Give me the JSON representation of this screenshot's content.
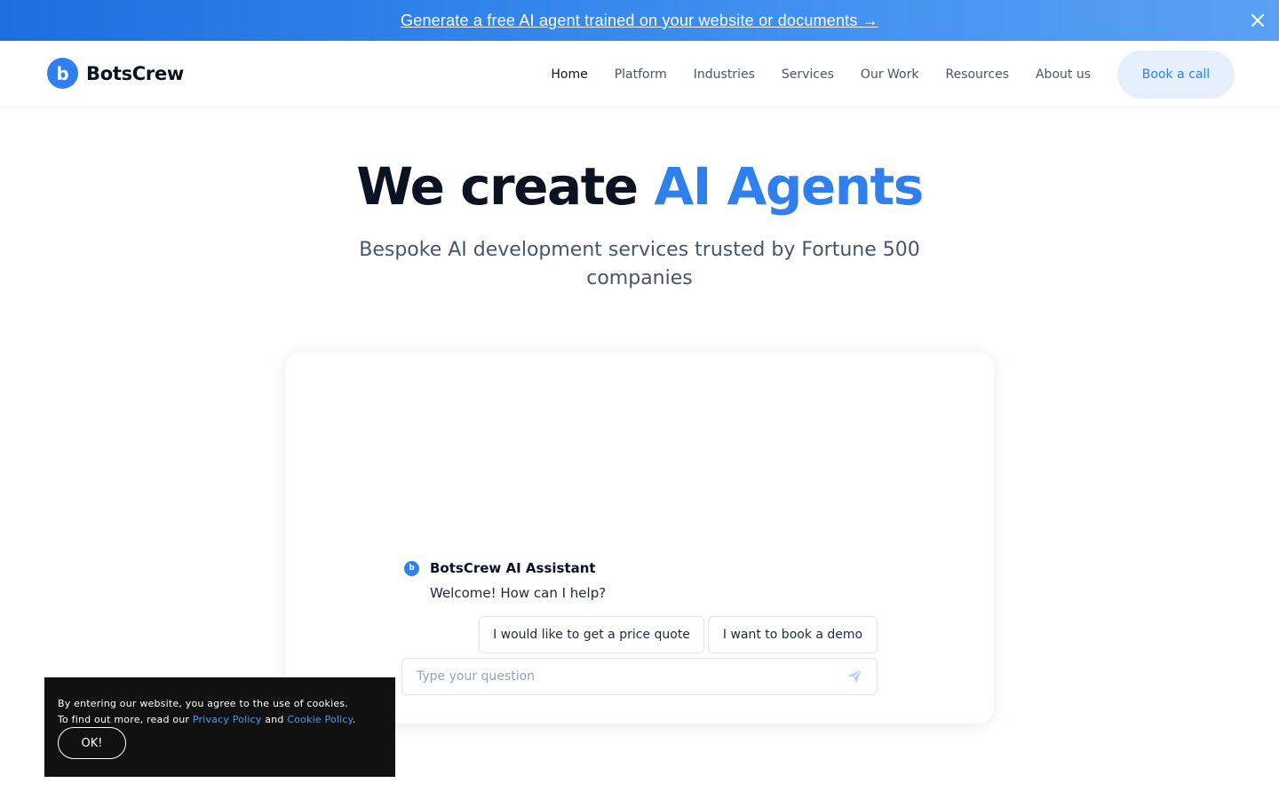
{
  "banner": {
    "link_text": "Generate a free AI agent trained on your website or documents →",
    "close_icon": "close-icon"
  },
  "header": {
    "logo_text": "BotsCrew",
    "logo_letter": "b",
    "nav": [
      {
        "label": "Home",
        "active": true
      },
      {
        "label": "Platform",
        "active": false
      },
      {
        "label": "Industries",
        "active": false
      },
      {
        "label": "Services",
        "active": false
      },
      {
        "label": "Our Work",
        "active": false
      },
      {
        "label": "Resources",
        "active": false
      },
      {
        "label": "About us",
        "active": false
      }
    ],
    "cta_label": "Book a call"
  },
  "hero": {
    "title_prefix": "We create ",
    "title_accent": "AI Agents",
    "subtitle": "Bespoke AI development services trusted by Fortune 500 companies"
  },
  "chat": {
    "assistant_name": "BotsCrew AI Assistant",
    "avatar_letter": "b",
    "welcome": "Welcome! How can I help?",
    "suggestions": [
      "I would like to get a price quote",
      "I want to book a demo"
    ],
    "input_placeholder": "Type your question",
    "send_icon": "send-icon"
  },
  "cookie": {
    "line1": "By entering our website, you agree to the use of cookies.",
    "line2_prefix": "To find out more, read our ",
    "privacy_link": "Privacy Policy",
    "and": " and ",
    "cookie_link": "Cookie Policy",
    "period": ".",
    "ok_label": "OK!"
  },
  "colors": {
    "accent": "#2f80ed",
    "banner_start": "#1d6fe0",
    "banner_end": "#5aa1f4",
    "cookie_bg": "#111111"
  }
}
